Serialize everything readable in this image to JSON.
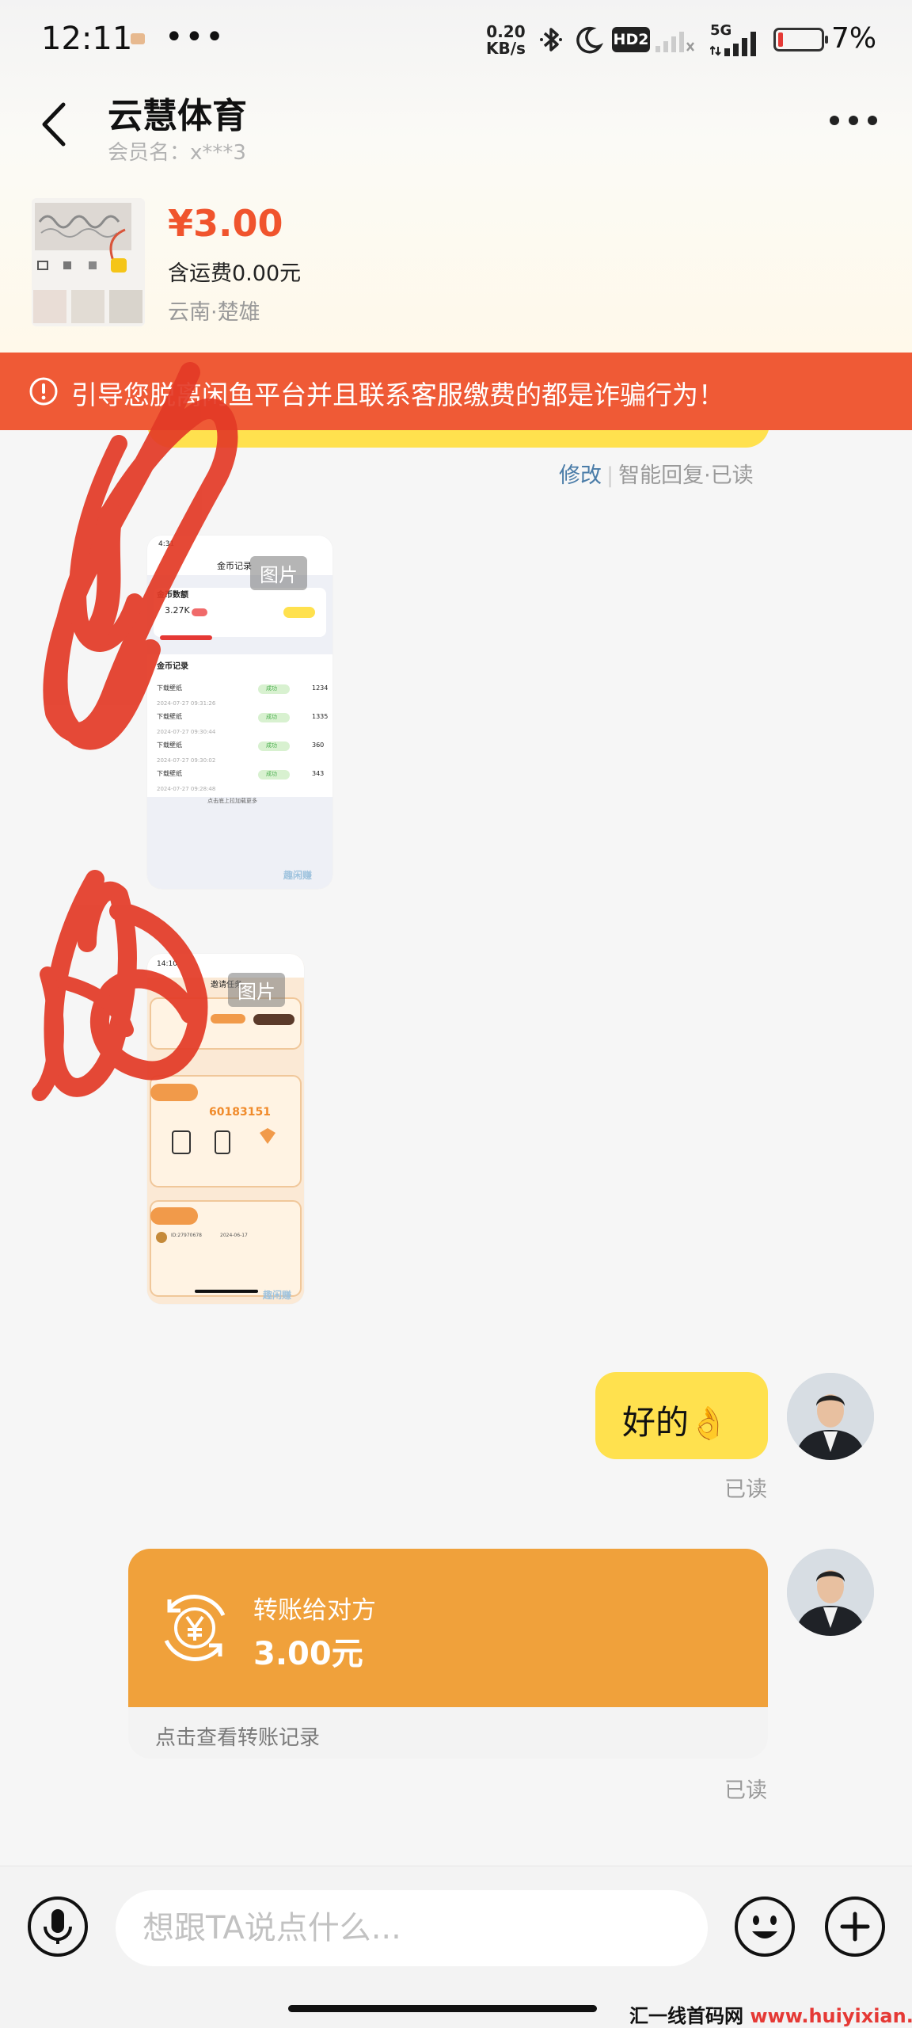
{
  "status_bar": {
    "time": "12:11",
    "dots": "•••",
    "speed_value": "0.20",
    "speed_unit": "KB/s",
    "hd_label": "HD2",
    "network_label": "5G",
    "battery_percent": "7%",
    "battery_level": 0.07
  },
  "header": {
    "title": "云慧体育",
    "member_label": "会员名：x***3"
  },
  "product": {
    "price": "¥3.00",
    "shipping": "含运费0.00元",
    "location": "云南·楚雄"
  },
  "banner": {
    "text": "引导您脱离闲鱼平台并且联系客服缴费的都是诈骗行为！",
    "color": "#ef5a36"
  },
  "first_message_status": {
    "edit": "修改",
    "auto_reply": "智能回复",
    "read": "已读"
  },
  "image_messages": [
    {
      "label": "图片",
      "screenshot": {
        "time": "4:31",
        "title": "金币记录",
        "section1": "金币数额",
        "amount": "3.27K",
        "records_title": "金币记录",
        "rows": [
          {
            "name": "下载壁纸",
            "date": "2024-07-27 09:31:26",
            "badge": "成功",
            "value": "1234"
          },
          {
            "name": "下载壁纸",
            "date": "2024-07-27 09:30:44",
            "badge": "成功",
            "value": "1335"
          },
          {
            "name": "下载壁纸",
            "date": "2024-07-27 09:30:02",
            "badge": "成功",
            "value": "360"
          },
          {
            "name": "下载壁纸",
            "date": "2024-07-27 09:28:48",
            "badge": "成功",
            "value": "343"
          }
        ],
        "footer": "点击底上拉加载更多",
        "watermark": "趣闲赚"
      }
    },
    {
      "label": "图片",
      "screenshot": {
        "time": "14:10",
        "title": "邀请任务",
        "invite_code": "60183151",
        "friend_id": "ID:27970678",
        "friend_date": "2024-06-17",
        "watermark": "趣闲赚"
      }
    }
  ],
  "ok_message": {
    "text": "好的",
    "emoji": "👌",
    "read": "已读"
  },
  "transfer": {
    "title": "转账给对方",
    "amount": "3.00元",
    "link": "点击查看转账记录",
    "read": "已读",
    "color": "#f0a13b"
  },
  "input": {
    "placeholder": "想跟TA说点什么..."
  },
  "watermark": {
    "prefix": "汇一线首码网 ",
    "url": "www.huiyixian.com"
  }
}
